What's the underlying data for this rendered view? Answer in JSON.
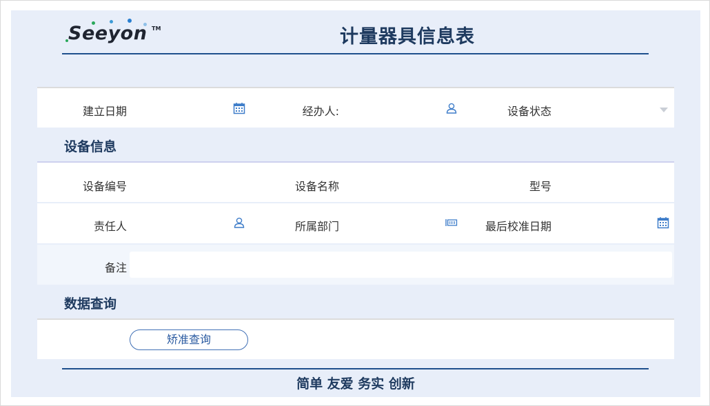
{
  "header": {
    "logo_text": "Seeyon",
    "logo_tm": "TM",
    "title": "计量器具信息表"
  },
  "basic_row": {
    "created_date_label": "建立日期",
    "handler_label": "经办人:",
    "device_status_label": "设备状态"
  },
  "device_info": {
    "section_title": "设备信息",
    "device_no_label": "设备编号",
    "device_name_label": "设备名称",
    "model_label": "型号",
    "owner_label": "责任人",
    "department_label": "所属部门",
    "last_calibration_label": "最后校准日期",
    "remark_label": "备注",
    "remark_value": ""
  },
  "data_query": {
    "section_title": "数据查询",
    "query_button_label": "矫准查询"
  },
  "footer": {
    "slogan": "简单 友爱 务实 创新"
  },
  "colors": {
    "background": "#e8eef9",
    "title": "#1e3a5f",
    "rule": "#1d4f8c",
    "icon": "#3d7cc9",
    "button_border": "#3f6fb5"
  },
  "icons": {
    "date": "calendar-icon",
    "person": "person-icon",
    "dropdown": "chevron-down-icon",
    "department": "org-chart-icon"
  }
}
